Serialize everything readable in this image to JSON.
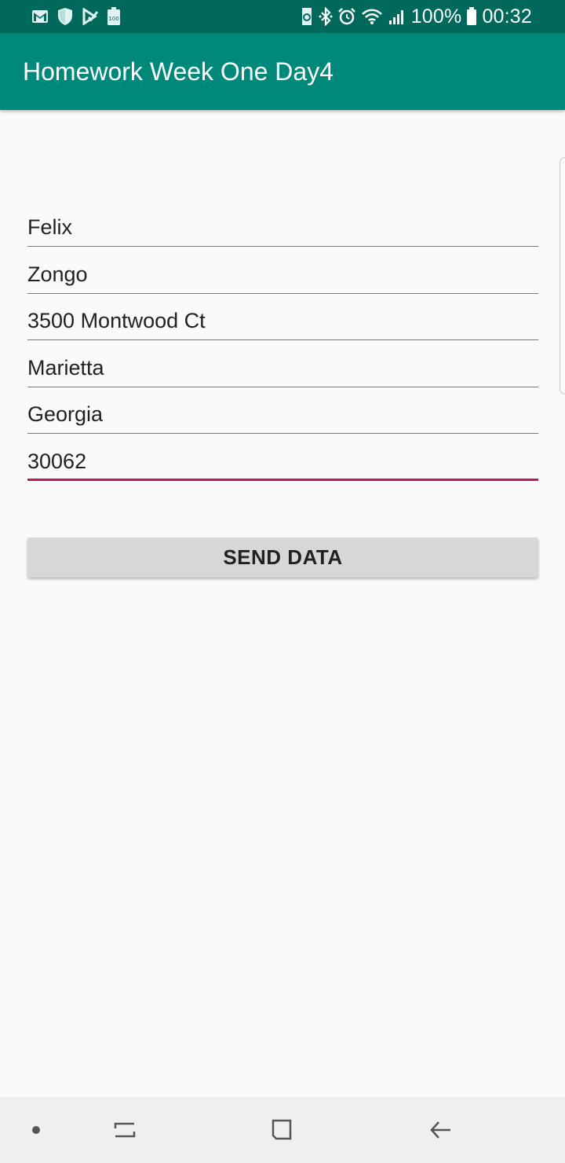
{
  "status_bar": {
    "battery_percent": "100%",
    "time": "00:32",
    "left_icons": [
      "gmail-icon",
      "shield-icon",
      "check-notification-icon",
      "battery-saver-icon"
    ],
    "right_icons": [
      "sync-icon",
      "bluetooth-icon",
      "alarm-icon",
      "wifi-icon",
      "signal-icon",
      "battery-icon"
    ]
  },
  "app_bar": {
    "title": "Homework Week One Day4",
    "color": "#00897b",
    "status_color": "#00695c"
  },
  "form": {
    "fields": [
      {
        "value": "Felix"
      },
      {
        "value": "Zongo"
      },
      {
        "value": "3500 Montwood Ct"
      },
      {
        "value": "Marietta"
      },
      {
        "value": "Georgia"
      },
      {
        "value": "30062",
        "focused": true
      }
    ],
    "focus_color": "#c2185b",
    "send_button_label": "SEND DATA"
  },
  "nav_bar": {
    "items": [
      "dot-icon",
      "recent-apps-icon",
      "home-icon",
      "back-icon"
    ]
  }
}
